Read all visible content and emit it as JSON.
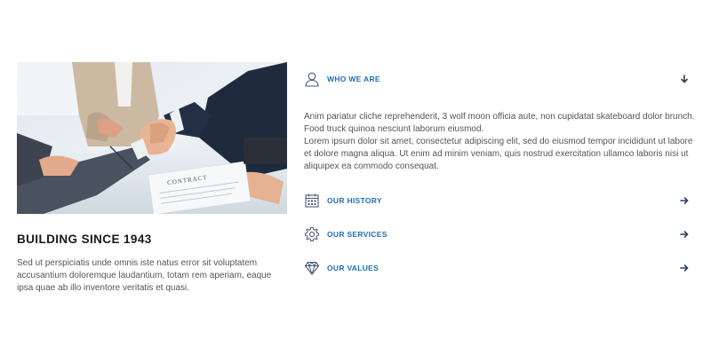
{
  "left": {
    "heading": "BUILDING SINCE 1943",
    "text": "Sed ut perspiciatis unde omnis iste natus error sit voluptatem accusantium doloremque laudantium, totam rem aperiam, eaque ipsa quae ab illo inventore veritatis et quasi.",
    "image_document_text": "CONTRACT"
  },
  "accordion": {
    "items": [
      {
        "title": "WHO WE ARE",
        "icon": "user-icon",
        "expanded": true,
        "arrow": "arrow-down-icon",
        "body_p1": "Anim pariatur cliche reprehenderit, 3 wolf moon officia aute, non cupidatat skateboard dolor brunch. Food truck quinoa nesciunt laborum eiusmod.",
        "body_p2": "Lorem ipsum dolor sit amet, consectetur adipiscing elit, sed do eiusmod tempor incididunt ut labore et dolore magna aliqua. Ut enim ad minim veniam, quis nostrud exercitation ullamco laboris nisi ut aliquipex ea commodo consequat."
      },
      {
        "title": "OUR HISTORY",
        "icon": "calendar-icon",
        "expanded": false,
        "arrow": "arrow-right-icon"
      },
      {
        "title": "OUR SERVICES",
        "icon": "gear-icon",
        "expanded": false,
        "arrow": "arrow-right-icon"
      },
      {
        "title": "OUR VALUES",
        "icon": "diamond-icon",
        "expanded": false,
        "arrow": "arrow-right-icon"
      }
    ]
  },
  "colors": {
    "accent": "#1d6fb8",
    "heading": "#1a1a1a",
    "body_text": "#555555",
    "icon_stroke": "#4a5a78",
    "arrow": "#2b3e5c"
  }
}
